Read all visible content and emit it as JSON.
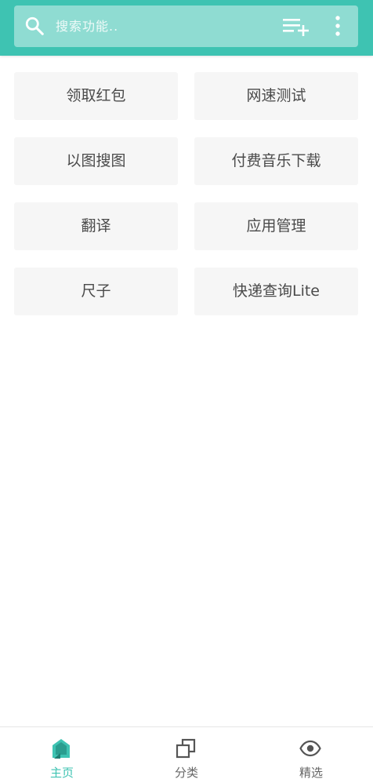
{
  "colors": {
    "accent": "#3ec3b2",
    "search_bg": "#8fdcd2",
    "tile_bg": "#f6f6f6",
    "text": "#4a4a4a",
    "nav_inactive": "#666666"
  },
  "header": {
    "search": {
      "icon": "search-icon",
      "placeholder": "搜索功能.."
    },
    "actions": [
      {
        "icon": "playlist-add-icon"
      },
      {
        "icon": "more-vertical-icon"
      }
    ]
  },
  "features": [
    {
      "label": "领取红包"
    },
    {
      "label": "网速测试"
    },
    {
      "label": "以图搜图"
    },
    {
      "label": "付费音乐下载"
    },
    {
      "label": "翻译"
    },
    {
      "label": "应用管理"
    },
    {
      "label": "尺子"
    },
    {
      "label": "快递查询Lite"
    }
  ],
  "bottom_nav": {
    "active_index": 0,
    "items": [
      {
        "label": "主页",
        "icon": "home-icon"
      },
      {
        "label": "分类",
        "icon": "category-icon"
      },
      {
        "label": "精选",
        "icon": "eye-icon"
      }
    ]
  }
}
